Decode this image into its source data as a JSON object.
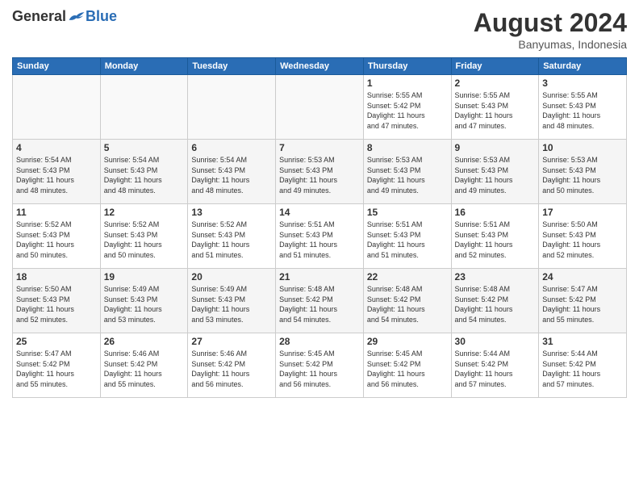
{
  "header": {
    "logo_general": "General",
    "logo_blue": "Blue",
    "month_title": "August 2024",
    "subtitle": "Banyumas, Indonesia"
  },
  "weekdays": [
    "Sunday",
    "Monday",
    "Tuesday",
    "Wednesday",
    "Thursday",
    "Friday",
    "Saturday"
  ],
  "weeks": [
    [
      {
        "day": "",
        "info": ""
      },
      {
        "day": "",
        "info": ""
      },
      {
        "day": "",
        "info": ""
      },
      {
        "day": "",
        "info": ""
      },
      {
        "day": "1",
        "info": "Sunrise: 5:55 AM\nSunset: 5:42 PM\nDaylight: 11 hours\nand 47 minutes."
      },
      {
        "day": "2",
        "info": "Sunrise: 5:55 AM\nSunset: 5:43 PM\nDaylight: 11 hours\nand 47 minutes."
      },
      {
        "day": "3",
        "info": "Sunrise: 5:55 AM\nSunset: 5:43 PM\nDaylight: 11 hours\nand 48 minutes."
      }
    ],
    [
      {
        "day": "4",
        "info": "Sunrise: 5:54 AM\nSunset: 5:43 PM\nDaylight: 11 hours\nand 48 minutes."
      },
      {
        "day": "5",
        "info": "Sunrise: 5:54 AM\nSunset: 5:43 PM\nDaylight: 11 hours\nand 48 minutes."
      },
      {
        "day": "6",
        "info": "Sunrise: 5:54 AM\nSunset: 5:43 PM\nDaylight: 11 hours\nand 48 minutes."
      },
      {
        "day": "7",
        "info": "Sunrise: 5:53 AM\nSunset: 5:43 PM\nDaylight: 11 hours\nand 49 minutes."
      },
      {
        "day": "8",
        "info": "Sunrise: 5:53 AM\nSunset: 5:43 PM\nDaylight: 11 hours\nand 49 minutes."
      },
      {
        "day": "9",
        "info": "Sunrise: 5:53 AM\nSunset: 5:43 PM\nDaylight: 11 hours\nand 49 minutes."
      },
      {
        "day": "10",
        "info": "Sunrise: 5:53 AM\nSunset: 5:43 PM\nDaylight: 11 hours\nand 50 minutes."
      }
    ],
    [
      {
        "day": "11",
        "info": "Sunrise: 5:52 AM\nSunset: 5:43 PM\nDaylight: 11 hours\nand 50 minutes."
      },
      {
        "day": "12",
        "info": "Sunrise: 5:52 AM\nSunset: 5:43 PM\nDaylight: 11 hours\nand 50 minutes."
      },
      {
        "day": "13",
        "info": "Sunrise: 5:52 AM\nSunset: 5:43 PM\nDaylight: 11 hours\nand 51 minutes."
      },
      {
        "day": "14",
        "info": "Sunrise: 5:51 AM\nSunset: 5:43 PM\nDaylight: 11 hours\nand 51 minutes."
      },
      {
        "day": "15",
        "info": "Sunrise: 5:51 AM\nSunset: 5:43 PM\nDaylight: 11 hours\nand 51 minutes."
      },
      {
        "day": "16",
        "info": "Sunrise: 5:51 AM\nSunset: 5:43 PM\nDaylight: 11 hours\nand 52 minutes."
      },
      {
        "day": "17",
        "info": "Sunrise: 5:50 AM\nSunset: 5:43 PM\nDaylight: 11 hours\nand 52 minutes."
      }
    ],
    [
      {
        "day": "18",
        "info": "Sunrise: 5:50 AM\nSunset: 5:43 PM\nDaylight: 11 hours\nand 52 minutes."
      },
      {
        "day": "19",
        "info": "Sunrise: 5:49 AM\nSunset: 5:43 PM\nDaylight: 11 hours\nand 53 minutes."
      },
      {
        "day": "20",
        "info": "Sunrise: 5:49 AM\nSunset: 5:43 PM\nDaylight: 11 hours\nand 53 minutes."
      },
      {
        "day": "21",
        "info": "Sunrise: 5:48 AM\nSunset: 5:42 PM\nDaylight: 11 hours\nand 54 minutes."
      },
      {
        "day": "22",
        "info": "Sunrise: 5:48 AM\nSunset: 5:42 PM\nDaylight: 11 hours\nand 54 minutes."
      },
      {
        "day": "23",
        "info": "Sunrise: 5:48 AM\nSunset: 5:42 PM\nDaylight: 11 hours\nand 54 minutes."
      },
      {
        "day": "24",
        "info": "Sunrise: 5:47 AM\nSunset: 5:42 PM\nDaylight: 11 hours\nand 55 minutes."
      }
    ],
    [
      {
        "day": "25",
        "info": "Sunrise: 5:47 AM\nSunset: 5:42 PM\nDaylight: 11 hours\nand 55 minutes."
      },
      {
        "day": "26",
        "info": "Sunrise: 5:46 AM\nSunset: 5:42 PM\nDaylight: 11 hours\nand 55 minutes."
      },
      {
        "day": "27",
        "info": "Sunrise: 5:46 AM\nSunset: 5:42 PM\nDaylight: 11 hours\nand 56 minutes."
      },
      {
        "day": "28",
        "info": "Sunrise: 5:45 AM\nSunset: 5:42 PM\nDaylight: 11 hours\nand 56 minutes."
      },
      {
        "day": "29",
        "info": "Sunrise: 5:45 AM\nSunset: 5:42 PM\nDaylight: 11 hours\nand 56 minutes."
      },
      {
        "day": "30",
        "info": "Sunrise: 5:44 AM\nSunset: 5:42 PM\nDaylight: 11 hours\nand 57 minutes."
      },
      {
        "day": "31",
        "info": "Sunrise: 5:44 AM\nSunset: 5:42 PM\nDaylight: 11 hours\nand 57 minutes."
      }
    ]
  ]
}
